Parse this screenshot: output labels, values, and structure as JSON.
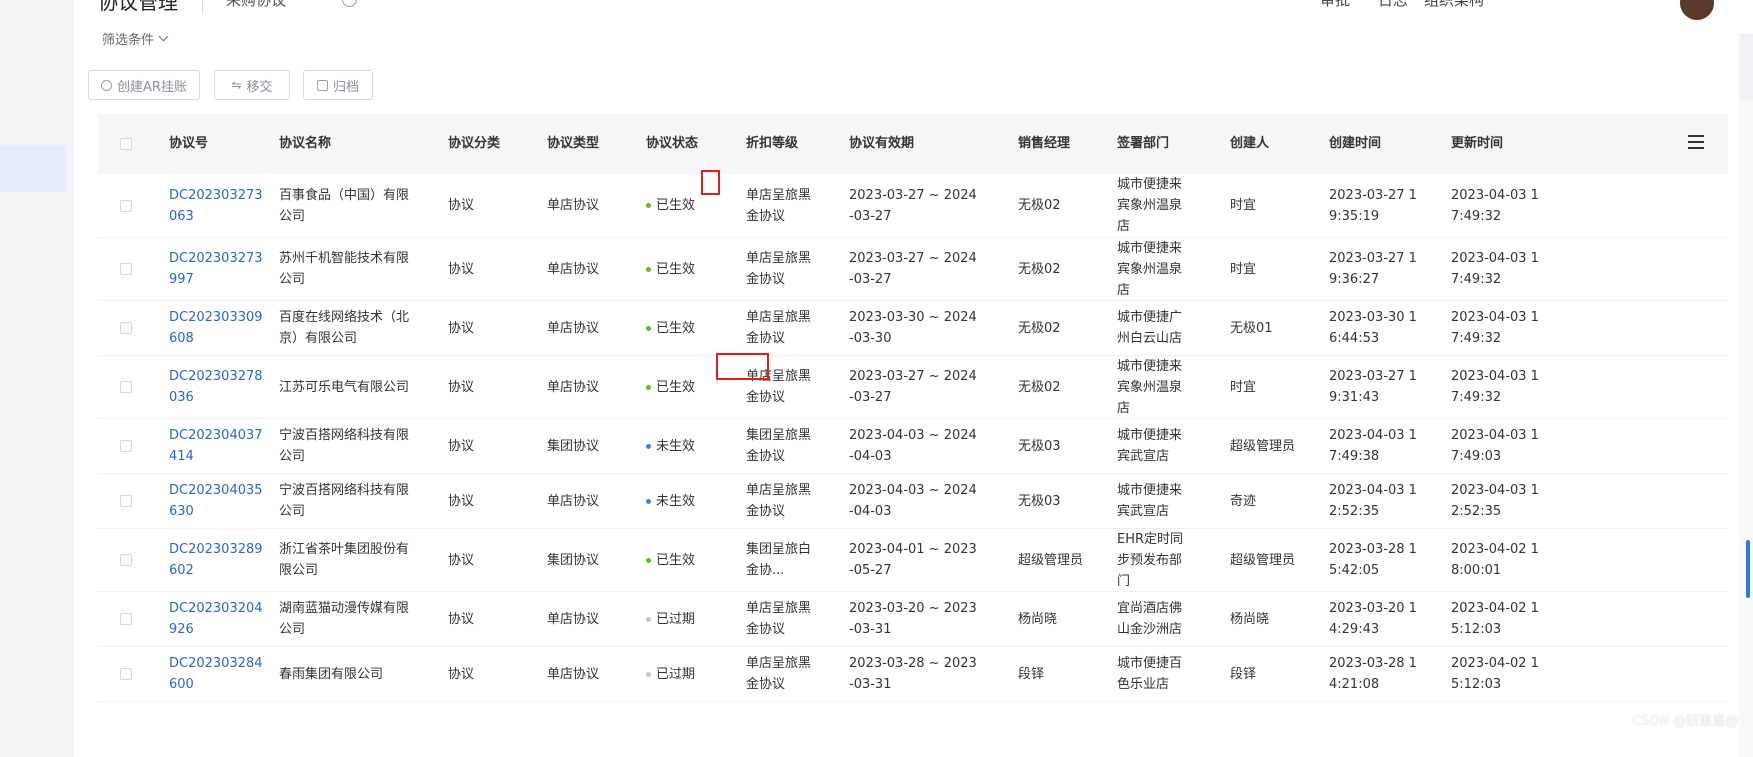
{
  "topbar": {
    "title": "协议管理",
    "subtitle": "采购协议",
    "nav": [
      "审批",
      "日志",
      "组织架构"
    ]
  },
  "filter_toggle": "筛选条件",
  "toolbar": [
    {
      "label": "创建AR挂账",
      "icon": "plus-circle-icon"
    },
    {
      "label": "移交",
      "icon": "transfer-icon"
    },
    {
      "label": "归档",
      "icon": "archive-icon"
    }
  ],
  "columns": [
    "协议号",
    "协议名称",
    "协议分类",
    "协议类型",
    "协议状态",
    "折扣等级",
    "协议有效期",
    "销售经理",
    "签署部门",
    "创建人",
    "创建时间",
    "更新时间"
  ],
  "status_colors": {
    "已生效": "#52c41a",
    "未生效": "#2f86f6",
    "已过期": "#c0c4cc"
  },
  "rows": [
    {
      "code": "DC202303273063",
      "name": "百事食品（中国）有限公司",
      "category": "协议",
      "type": "单店协议",
      "status": "已生效",
      "level": "单店呈旅黑金协议",
      "validity": "2023-03-27 ~ 2024-03-27",
      "manager": "无极02",
      "dept": "城市便捷来宾象州温泉店",
      "creator": "时宜",
      "created": "2023-03-27 19:35:19",
      "updated": "2023-04-03 17:49:32"
    },
    {
      "code": "DC202303273997",
      "name": "苏州千机智能技术有限公司",
      "category": "协议",
      "type": "单店协议",
      "status": "已生效",
      "level": "单店呈旅黑金协议",
      "validity": "2023-03-27 ~ 2024-03-27",
      "manager": "无极02",
      "dept": "城市便捷来宾象州温泉店",
      "creator": "时宜",
      "created": "2023-03-27 19:36:27",
      "updated": "2023-04-03 17:49:32"
    },
    {
      "code": "DC202303309608",
      "name": "百度在线网络技术（北京）有限公司",
      "category": "协议",
      "type": "单店协议",
      "status": "已生效",
      "level": "单店呈旅黑金协议",
      "validity": "2023-03-30 ~ 2024-03-30",
      "manager": "无极02",
      "dept": "城市便捷广州白云山店",
      "creator": "无极01",
      "created": "2023-03-30 16:44:53",
      "updated": "2023-04-03 17:49:32"
    },
    {
      "code": "DC202303278036",
      "name": "江苏可乐电气有限公司",
      "category": "协议",
      "type": "单店协议",
      "status": "已生效",
      "level": "单店呈旅黑金协议",
      "validity": "2023-03-27 ~ 2024-03-27",
      "manager": "无极02",
      "dept": "城市便捷来宾象州温泉店",
      "creator": "时宜",
      "created": "2023-03-27 19:31:43",
      "updated": "2023-04-03 17:49:32"
    },
    {
      "code": "DC202304037414",
      "name": "宁波百搭网络科技有限公司",
      "category": "协议",
      "type": "集团协议",
      "status": "未生效",
      "level": "集团呈旅黑金协议",
      "validity": "2023-04-03 ~ 2024-04-03",
      "manager": "无极03",
      "dept": "城市便捷来宾武宣店",
      "creator": "超级管理员",
      "created": "2023-04-03 17:49:38",
      "updated": "2023-04-03 17:49:03"
    },
    {
      "code": "DC202304035630",
      "name": "宁波百搭网络科技有限公司",
      "category": "协议",
      "type": "单店协议",
      "status": "未生效",
      "level": "单店呈旅黑金协议",
      "validity": "2023-04-03 ~ 2024-04-03",
      "manager": "无极03",
      "dept": "城市便捷来宾武宣店",
      "creator": "奇迹",
      "created": "2023-04-03 12:52:35",
      "updated": "2023-04-03 12:52:35"
    },
    {
      "code": "DC202303289602",
      "name": "浙江省茶叶集团股份有限公司",
      "category": "协议",
      "type": "集团协议",
      "status": "已生效",
      "level": "集团呈旅白金协...",
      "validity": "2023-04-01 ~ 2023-05-27",
      "manager": "超级管理员",
      "dept": "EHR定时同步预发布部门",
      "creator": "超级管理员",
      "created": "2023-03-28 15:42:05",
      "updated": "2023-04-02 18:00:01"
    },
    {
      "code": "DC202303204926",
      "name": "湖南蓝猫动漫传媒有限公司",
      "category": "协议",
      "type": "单店协议",
      "status": "已过期",
      "level": "单店呈旅黑金协议",
      "validity": "2023-03-20 ~ 2023-03-31",
      "manager": "杨尚晓",
      "dept": "宜尚酒店佛山金沙洲店",
      "creator": "杨尚晓",
      "created": "2023-03-20 14:29:43",
      "updated": "2023-04-02 15:12:03"
    },
    {
      "code": "DC202303284600",
      "name": "春雨集团有限公司",
      "category": "协议",
      "type": "单店协议",
      "status": "已过期",
      "level": "单店呈旅黑金协议",
      "validity": "2023-03-28 ~ 2023-03-31",
      "manager": "段铎",
      "dept": "城市便捷百色乐业店",
      "creator": "段铎",
      "created": "2023-03-28 14:21:08",
      "updated": "2023-04-02 15:12:03"
    }
  ],
  "watermark": "CSDN @妍崽崽@"
}
